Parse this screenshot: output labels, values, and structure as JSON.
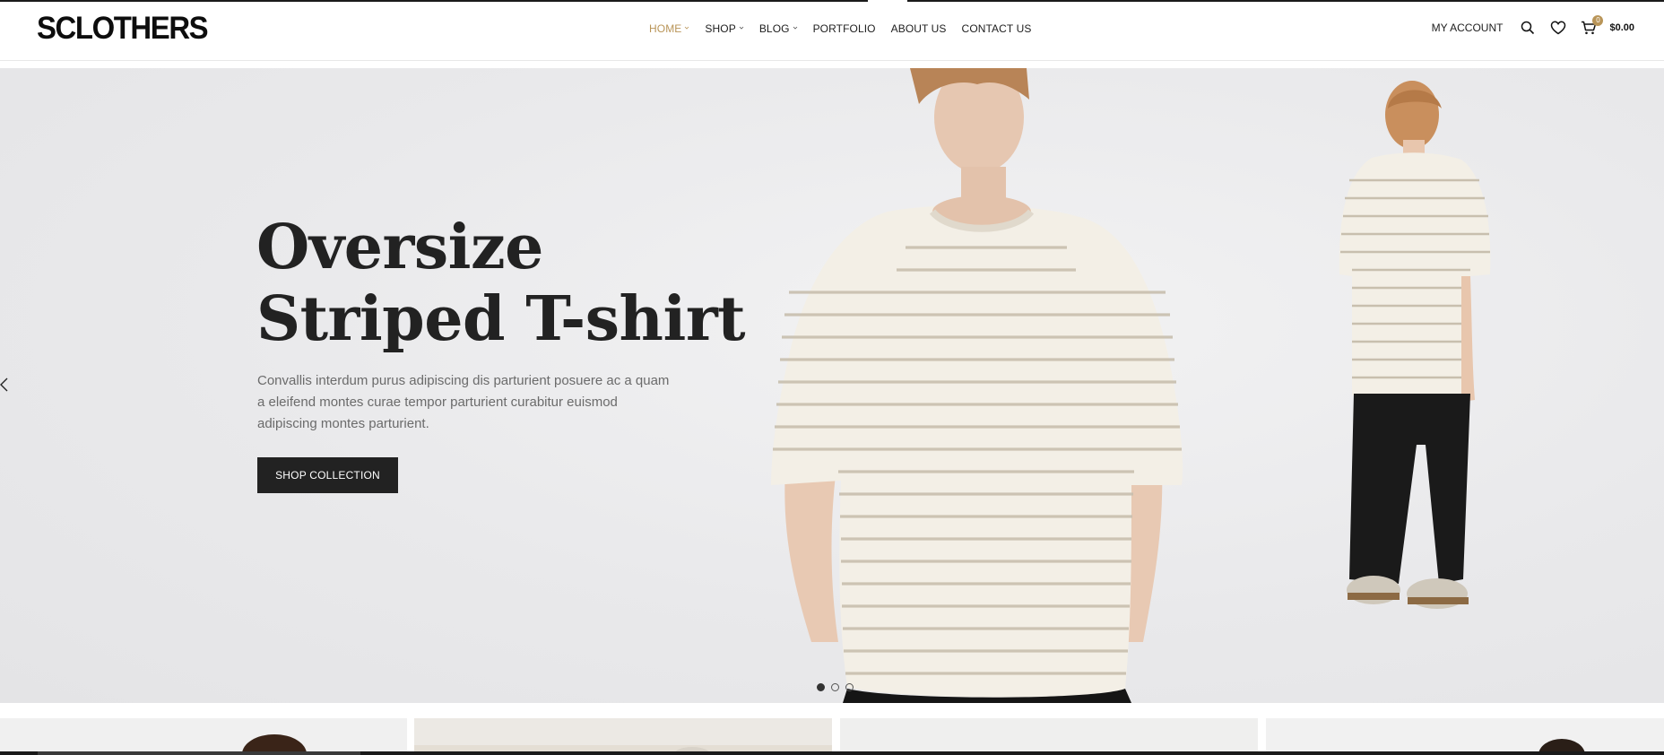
{
  "brand": {
    "logo_text": "SCLOTHERS"
  },
  "nav": {
    "items": [
      {
        "label": "HOME",
        "has_dropdown": true,
        "active": true
      },
      {
        "label": "SHOP",
        "has_dropdown": true,
        "active": false
      },
      {
        "label": "BLOG",
        "has_dropdown": true,
        "active": false
      },
      {
        "label": "PORTFOLIO",
        "has_dropdown": false,
        "active": false
      },
      {
        "label": "ABOUT US",
        "has_dropdown": false,
        "active": false
      },
      {
        "label": "CONTACT US",
        "has_dropdown": false,
        "active": false
      }
    ]
  },
  "header_right": {
    "account_label": "MY ACCOUNT",
    "search_icon": "search-icon",
    "wishlist_icon": "heart-icon",
    "cart_icon": "cart-icon",
    "cart_count": "0",
    "cart_total": "$0.00"
  },
  "hero": {
    "title_line1": "Oversize",
    "title_line2": "Striped T-shirt",
    "description": "Convallis interdum purus adipiscing dis parturient posuere ac a quam a eleifend montes curae tempor parturient curabitur euismod adipiscing montes parturient.",
    "button_label": "SHOP COLLECTION",
    "prev_icon": "chevron-left-icon",
    "slides_total": 3,
    "active_slide": 1
  },
  "colors": {
    "accent": "#b99558",
    "text_dark": "#222222",
    "button_bg": "#222222",
    "hero_bg": "#ebebed"
  }
}
